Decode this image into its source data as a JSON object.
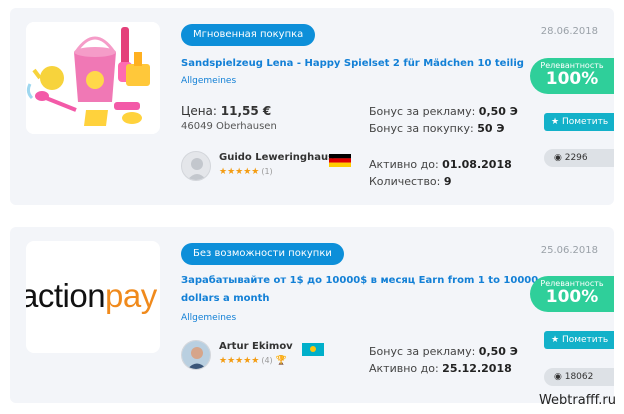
{
  "listings": [
    {
      "badge": "Мгновенная покупка",
      "date": "28.06.2018",
      "title": "Sandspielzeug Lena - Happy Spielset 2 für Mädchen 10 teilig",
      "category": "Allgemeines",
      "price_label": "Цена:",
      "price_value": "11,55 €",
      "city": "46049 Oberhausen",
      "bonus_ad_label": "Бонус за рекламу:",
      "bonus_ad_value": "0,50 Э",
      "bonus_buy_label": "Бонус за покупку:",
      "bonus_buy_value": "50 Э",
      "user_name": "Guido Leweringhaus",
      "stars": "★★★★★",
      "rating_count": "(1)",
      "active_label": "Активно до:",
      "active_value": "01.08.2018",
      "qty_label": "Количество:",
      "qty_value": "9",
      "relevance_label": "Релевантность",
      "relevance_value": "100%",
      "mark_label": "Пометить",
      "views": "2296"
    },
    {
      "badge": "Без возможности покупки",
      "date": "25.06.2018",
      "title_line1": "Зарабатывайте от 1$ до 10000$ в месяц Earn from 1 to 10000",
      "title_line2": "dollars a month",
      "category": "Allgemeines",
      "logo_text": "actionpay",
      "bonus_ad_label": "Бонус за рекламу:",
      "bonus_ad_value": "0,50 Э",
      "user_name": "Artur Ekimov",
      "stars": "★★★★★",
      "rating_count": "(4)",
      "active_label": "Активно до:",
      "active_value": "25.12.2018",
      "relevance_label": "Релевантность",
      "relevance_value": "100%",
      "mark_label": "Пометить",
      "views": "18062"
    }
  ],
  "watermark": "Webtrafff.ru",
  "colors": {
    "badge_blue": "#0d8fd9",
    "title_blue": "#1380d6",
    "relevance_green": "#2fcf9a",
    "mark_teal": "#13b1c9",
    "stars_orange": "#f39c12",
    "card_bg": "#f3f5f9"
  },
  "icons": [
    "star-icon",
    "eye-icon",
    "germany-flag-icon",
    "kazakhstan-flag-icon",
    "trophy-icon",
    "user-avatar-icon"
  ]
}
